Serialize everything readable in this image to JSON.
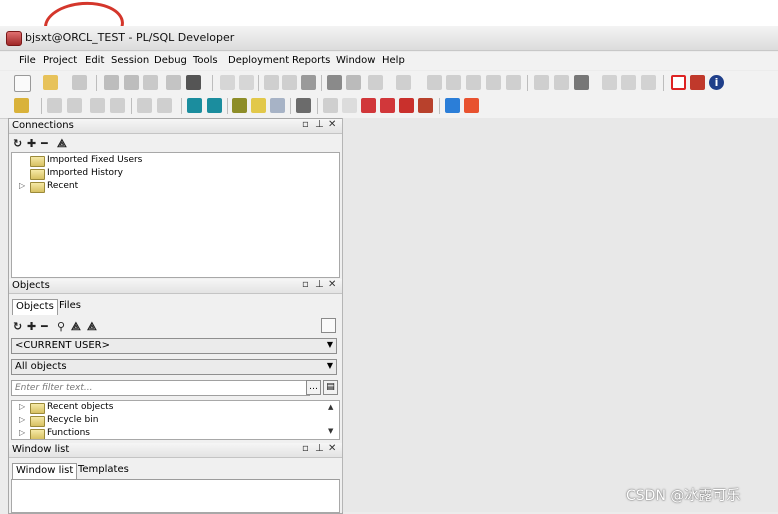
{
  "window": {
    "title": "bjsxt@ORCL_TEST - PL/SQL Developer"
  },
  "menu": [
    "File",
    "Project",
    "Edit",
    "Session",
    "Debug",
    "Tools",
    "Deployment",
    "Reports",
    "Window",
    "Help"
  ],
  "toolbar_icons": {
    "row1": [
      "new-icon",
      "open-icon",
      "print-icon",
      "save-icon",
      "save-all-icon",
      "copy-to-icon",
      "print-preview-icon",
      "compile-icon",
      "undo-icon",
      "redo-icon",
      "cut-icon",
      "copy-icon",
      "paste-icon",
      "find-icon",
      "find-next-icon",
      "indent-icon",
      "unindent-icon",
      "comment-icon",
      "uncomment-icon",
      "upper-icon",
      "lower-icon",
      "tile-horizontal-icon",
      "tile-vertical-icon",
      "cascade-icon",
      "window-list-icon",
      "oracle-icon",
      "pdf-icon",
      "info-icon"
    ],
    "row2": [
      "key-icon",
      "db-icon",
      "connect-icon",
      "disconnect-icon",
      "stop-icon",
      "execute-icon",
      "commit-icon",
      "rollback-icon",
      "report-icon",
      "tools-icon",
      "browser-icon",
      "wrench-icon",
      "object-icon",
      "compile-all-icon",
      "ruby-icon",
      "debug-icon",
      "brush-icon",
      "back-arrow-icon",
      "forward-arrow-icon"
    ]
  },
  "connections": {
    "title": "Connections",
    "items": [
      "Imported Fixed Users",
      "Imported History",
      "Recent"
    ]
  },
  "objects": {
    "title": "Objects",
    "tabs": [
      "Objects",
      "Files"
    ],
    "user_select": "<CURRENT USER>",
    "filter_select": "All objects",
    "filter_placeholder": "Enter filter text...",
    "items": [
      "Recent objects",
      "Recycle bin",
      "Functions"
    ]
  },
  "window_list": {
    "title": "Window list",
    "tabs": [
      "Window list",
      "Templates"
    ]
  },
  "watermark": "CSDN @冰露可乐",
  "colors": {
    "annotation": "#d4362b",
    "workspace": "#e8e8e8"
  }
}
